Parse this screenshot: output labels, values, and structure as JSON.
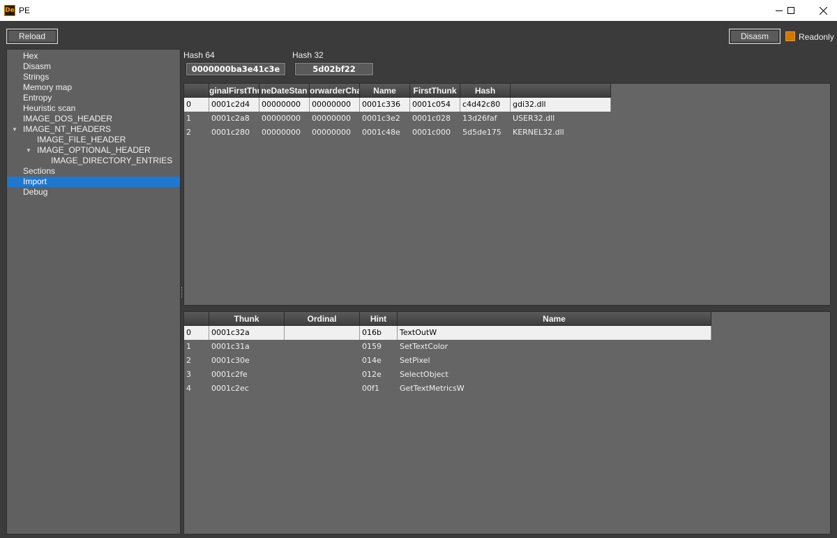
{
  "window": {
    "title": "PE",
    "icon": "De",
    "minimize_icon": "minimize-icon",
    "maximize_icon": "maximize-icon",
    "close_icon": "close-icon"
  },
  "toolbar": {
    "reload_label": "Reload",
    "disasm_label": "Disasm",
    "readonly_label": "Readonly",
    "readonly_checked": true,
    "accent": "#d07800"
  },
  "tree": {
    "items": [
      {
        "label": "Hex"
      },
      {
        "label": "Disasm"
      },
      {
        "label": "Strings"
      },
      {
        "label": "Memory map"
      },
      {
        "label": "Entropy"
      },
      {
        "label": "Heuristic scan"
      },
      {
        "label": "IMAGE_DOS_HEADER"
      },
      {
        "label": "IMAGE_NT_HEADERS",
        "expanded": true
      },
      {
        "label": "IMAGE_FILE_HEADER"
      },
      {
        "label": "IMAGE_OPTIONAL_HEADER",
        "expanded": true
      },
      {
        "label": "IMAGE_DIRECTORY_ENTRIES"
      },
      {
        "label": "Sections"
      },
      {
        "label": "Import",
        "selected": true
      },
      {
        "label": "Debug"
      }
    ],
    "selection_color": "#1e78d0"
  },
  "hashes": {
    "hash64_label": "Hash 64",
    "hash64_value": "0000000ba3e41c3e",
    "hash32_label": "Hash 32",
    "hash32_value": "5d02bf22"
  },
  "imports_table": {
    "headers": [
      "",
      "ginalFirstThu",
      "neDateStan",
      "orwarderCha",
      "Name",
      "FirstThunk",
      "Hash",
      ""
    ],
    "rows": [
      [
        "0",
        "0001c2d4",
        "00000000",
        "00000000",
        "0001c336",
        "0001c054",
        "c4d42c80",
        "gdi32.dll"
      ],
      [
        "1",
        "0001c2a8",
        "00000000",
        "00000000",
        "0001c3e2",
        "0001c028",
        "13d26faf",
        "USER32.dll"
      ],
      [
        "2",
        "0001c280",
        "00000000",
        "00000000",
        "0001c48e",
        "0001c000",
        "5d5de175",
        "KERNEL32.dll"
      ]
    ],
    "selected_row": 0
  },
  "functions_table": {
    "headers": [
      "",
      "Thunk",
      "Ordinal",
      "Hint",
      "Name"
    ],
    "rows": [
      [
        "0",
        "0001c32a",
        "",
        "016b",
        "TextOutW"
      ],
      [
        "1",
        "0001c31a",
        "",
        "0159",
        "SetTextColor"
      ],
      [
        "2",
        "0001c30e",
        "",
        "014e",
        "SetPixel"
      ],
      [
        "3",
        "0001c2fe",
        "",
        "012e",
        "SelectObject"
      ],
      [
        "4",
        "0001c2ec",
        "",
        "00f1",
        "GetTextMetricsW"
      ]
    ],
    "selected_row": 0
  }
}
